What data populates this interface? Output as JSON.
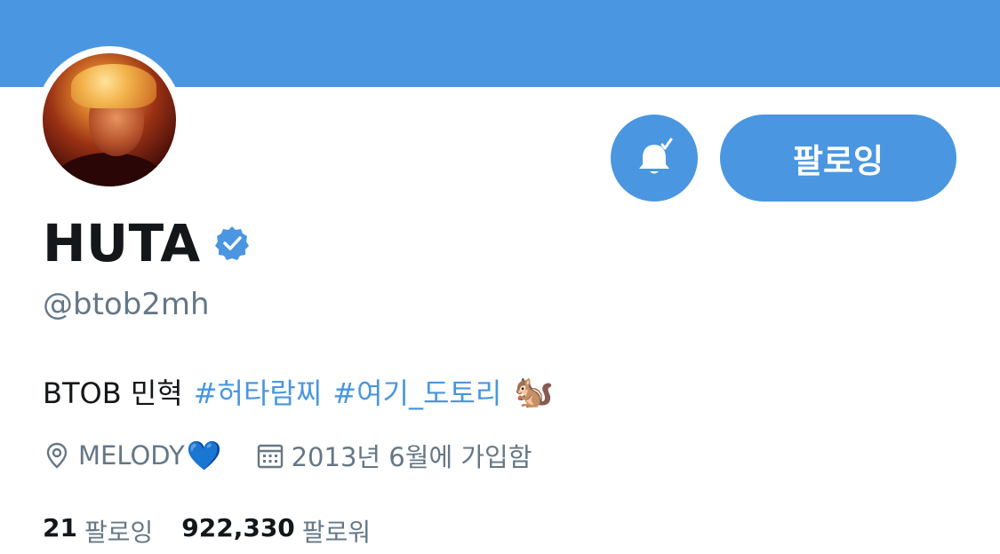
{
  "colors": {
    "banner": "#4a96e0",
    "accent": "#4a96e0",
    "text_primary": "#14171a",
    "text_secondary": "#657786"
  },
  "profile": {
    "display_name": "HUTA",
    "verified_icon": "verified-badge-icon",
    "handle": "@btob2mh",
    "bio_text": "BTOB 민혁",
    "hashtags": [
      "#허타람찌",
      "#여기_도토리"
    ],
    "bio_emoji": "🐿️",
    "location": "MELODY",
    "location_emoji": "💙",
    "joined": "2013년 6월에 가입함"
  },
  "actions": {
    "notification_icon": "bell-check-icon",
    "follow_label": "팔로잉"
  },
  "stats": {
    "following_count": "21",
    "following_label": "팔로잉",
    "followers_count": "922,330",
    "followers_label": "팔로워"
  }
}
